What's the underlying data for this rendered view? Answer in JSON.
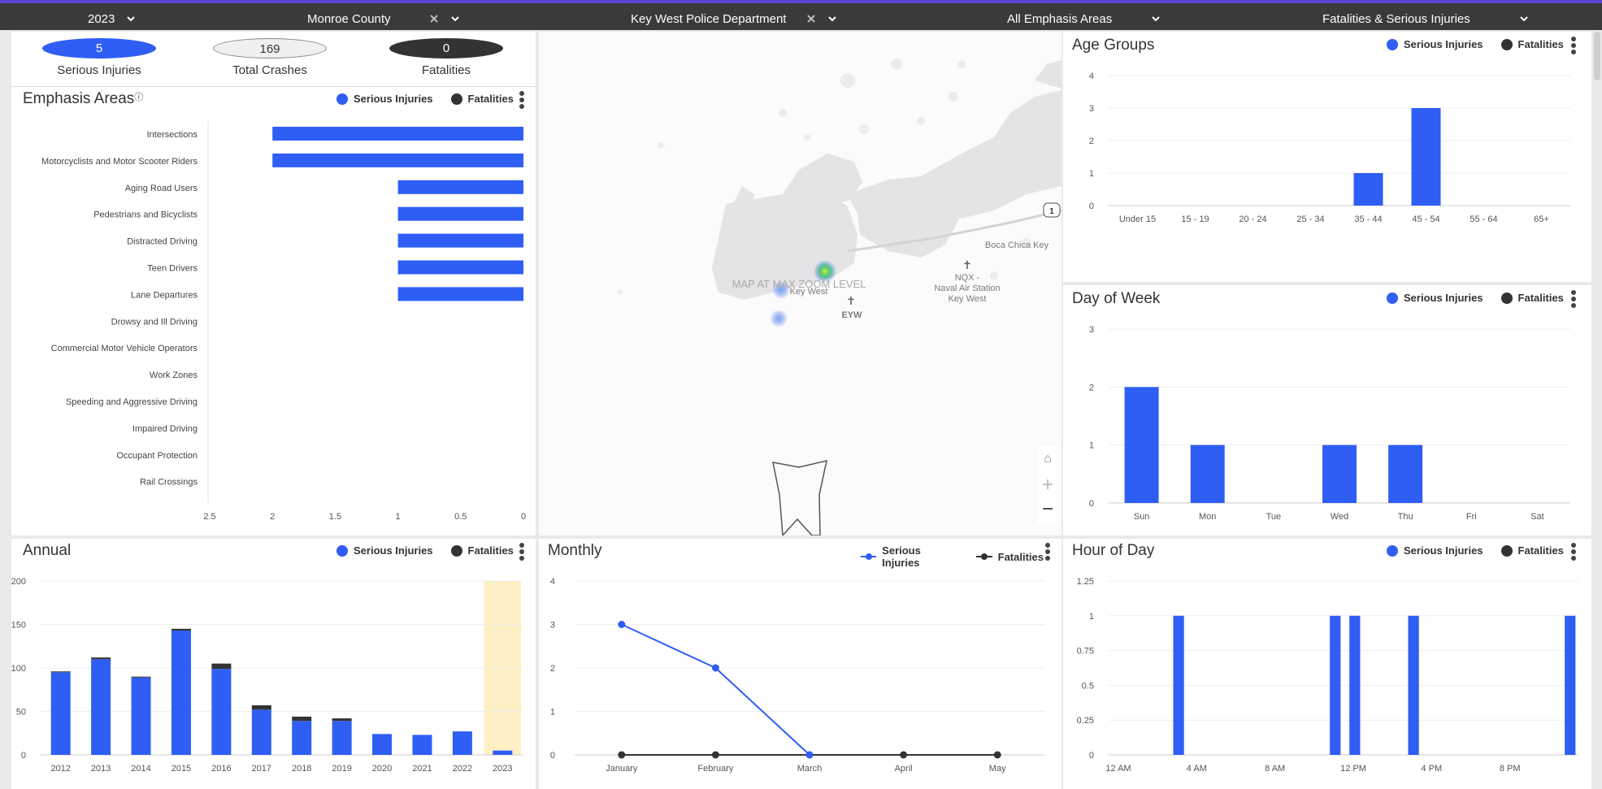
{
  "filters": {
    "year": "2023",
    "county": "Monroe County",
    "agency": "Key West Police Department",
    "emphasis": "All Emphasis Areas",
    "severity": "Fatalities & Serious Injuries"
  },
  "kpis": {
    "serious_injuries": {
      "value": "5",
      "label": "Serious Injuries"
    },
    "total_crashes": {
      "value": "169",
      "label": "Total Crashes"
    },
    "fatalities": {
      "value": "0",
      "label": "Fatalities"
    }
  },
  "legend": {
    "serious": "Serious Injuries",
    "fatal": "Fatalities"
  },
  "colors": {
    "serious": "#2f5ef5",
    "fatal": "#333333",
    "highlight": "#fdf0c4",
    "topbar": "#3a3a3a",
    "accent": "#5b43d6"
  },
  "titles": {
    "emphasis": "Emphasis Areas",
    "annual": "Annual",
    "monthly": "Monthly",
    "hour": "Hour of Day",
    "age": "Age Groups",
    "dow": "Day of Week"
  },
  "map": {
    "zoom_msg": "MAP AT MAX ZOOM LEVEL",
    "labels": [
      "Key West",
      "EYW",
      "NQX -",
      "Naval Air Station",
      "Key West",
      "Boca Chica Key"
    ],
    "shield": "1"
  },
  "chart_data": [
    {
      "id": "emphasis",
      "type": "bar",
      "orientation": "horizontal",
      "title": "Emphasis Areas",
      "categories": [
        "Intersections",
        "Motorcyclists and Motor Scooter Riders",
        "Aging Road Users",
        "Pedestrians and Bicyclists",
        "Distracted Driving",
        "Teen Drivers",
        "Lane Departures",
        "Drowsy and Ill Driving",
        "Commercial Motor Vehicle Operators",
        "Work Zones",
        "Speeding and Aggressive Driving",
        "Impaired Driving",
        "Occupant Protection",
        "Rail Crossings"
      ],
      "series": [
        {
          "name": "Serious Injuries",
          "values": [
            2,
            2,
            1,
            1,
            1,
            1,
            1,
            0,
            0,
            0,
            0,
            0,
            0,
            0
          ]
        },
        {
          "name": "Fatalities",
          "values": [
            0,
            0,
            0,
            0,
            0,
            0,
            0,
            0,
            0,
            0,
            0,
            0,
            0,
            0
          ]
        }
      ],
      "xlim": [
        2.5,
        0
      ],
      "x_ticks": [
        "2.5",
        "2",
        "1.5",
        "1",
        "0.5",
        "0"
      ]
    },
    {
      "id": "annual",
      "type": "bar",
      "stacked": true,
      "title": "Annual",
      "categories": [
        "2012",
        "2013",
        "2014",
        "2015",
        "2016",
        "2017",
        "2018",
        "2019",
        "2020",
        "2021",
        "2022",
        "2023"
      ],
      "series": [
        {
          "name": "Serious Injuries",
          "values": [
            95,
            110,
            89,
            143,
            99,
            52,
            39,
            39,
            24,
            23,
            27,
            5
          ]
        },
        {
          "name": "Fatalities",
          "values": [
            1,
            2,
            1,
            2,
            6,
            5,
            5,
            3,
            0,
            0,
            0,
            0
          ]
        }
      ],
      "highlight_category": "2023",
      "ylim": [
        0,
        200
      ],
      "y_ticks": [
        "0",
        "50",
        "100",
        "150",
        "200"
      ]
    },
    {
      "id": "monthly",
      "type": "line",
      "title": "Monthly",
      "categories": [
        "January",
        "February",
        "March",
        "April",
        "May"
      ],
      "series": [
        {
          "name": "Serious Injuries",
          "values": [
            3,
            2,
            0,
            null,
            null
          ]
        },
        {
          "name": "Fatalities",
          "values": [
            0,
            0,
            0,
            0,
            0
          ]
        }
      ],
      "ylim": [
        0,
        4
      ],
      "y_ticks": [
        "0",
        "1",
        "2",
        "3",
        "4"
      ]
    },
    {
      "id": "hour",
      "type": "bar",
      "title": "Hour of Day",
      "x_hours": [
        3,
        11,
        12,
        15,
        23
      ],
      "values": [
        1,
        1,
        1,
        1,
        1
      ],
      "series_name": "Serious Injuries",
      "xlim": [
        0,
        24
      ],
      "x_ticks": [
        "12 AM",
        "4 AM",
        "8 AM",
        "12 PM",
        "4 PM",
        "8 PM"
      ],
      "ylim": [
        0,
        1.25
      ],
      "y_ticks": [
        "0",
        "0.25",
        "0.5",
        "0.75",
        "1",
        "1.25"
      ]
    },
    {
      "id": "age",
      "type": "bar",
      "title": "Age Groups",
      "categories": [
        "Under 15",
        "15 - 19",
        "20 - 24",
        "25 - 34",
        "35 - 44",
        "45 - 54",
        "55 - 64",
        "65+"
      ],
      "series": [
        {
          "name": "Serious Injuries",
          "values": [
            0,
            0,
            0,
            0,
            1,
            3,
            0,
            0
          ]
        },
        {
          "name": "Fatalities",
          "values": [
            0,
            0,
            0,
            0,
            0,
            0,
            0,
            0
          ]
        }
      ],
      "ylim": [
        0,
        4
      ],
      "y_ticks": [
        "0",
        "1",
        "2",
        "3",
        "4"
      ]
    },
    {
      "id": "dow",
      "type": "bar",
      "title": "Day of Week",
      "categories": [
        "Sun",
        "Mon",
        "Tue",
        "Wed",
        "Thu",
        "Fri",
        "Sat"
      ],
      "series": [
        {
          "name": "Serious Injuries",
          "values": [
            2,
            1,
            0,
            1,
            1,
            0,
            0
          ]
        },
        {
          "name": "Fatalities",
          "values": [
            0,
            0,
            0,
            0,
            0,
            0,
            0
          ]
        }
      ],
      "ylim": [
        0,
        3
      ],
      "y_ticks": [
        "0",
        "1",
        "2",
        "3"
      ]
    }
  ]
}
